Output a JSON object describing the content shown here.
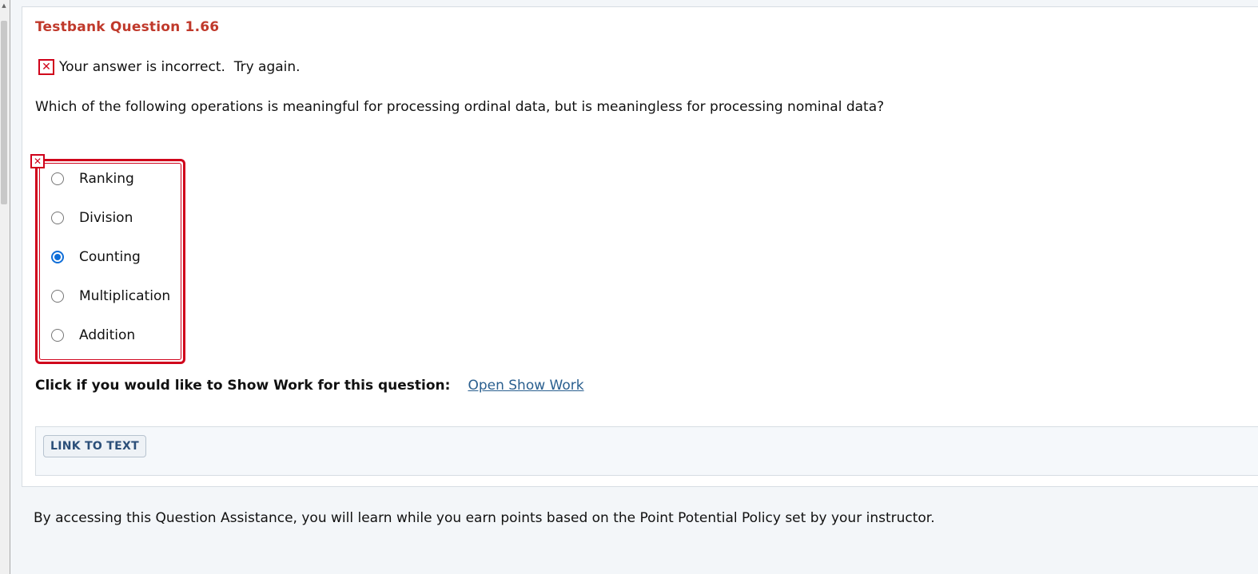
{
  "question": {
    "title": "Testbank Question 1.66",
    "feedback_icon": "close-icon",
    "feedback_text": "Your answer is incorrect.  Try again.",
    "prompt": "Which of the following operations is meaningful for processing ordinal data, but is meaningless for processing nominal data?",
    "options": [
      {
        "label": "Ranking",
        "selected": false
      },
      {
        "label": "Division",
        "selected": false
      },
      {
        "label": "Counting",
        "selected": true
      },
      {
        "label": "Multiplication",
        "selected": false
      },
      {
        "label": "Addition",
        "selected": false
      }
    ],
    "accent_color": "#d0021b",
    "title_color": "#c0392b"
  },
  "show_work": {
    "label": "Click if you would like to Show Work for this question:",
    "link": "Open Show Work"
  },
  "link_bar": {
    "button": "LINK TO TEXT"
  },
  "footer": {
    "text": "By accessing this Question Assistance, you will learn while you earn points based on the Point Potential Policy set by your instructor."
  }
}
